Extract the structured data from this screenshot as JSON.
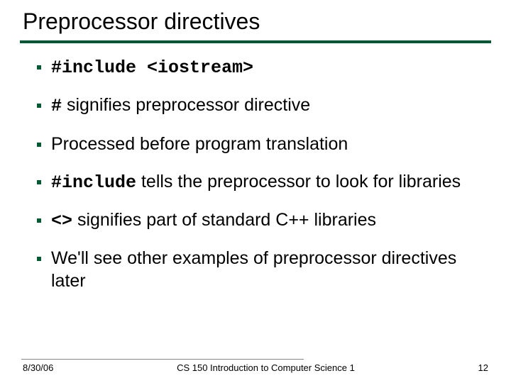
{
  "title": "Preprocessor directives",
  "bullets": {
    "b0": {
      "code": "#include <iostream>"
    },
    "b1": {
      "code": "#",
      "rest": " signifies preprocessor directive"
    },
    "b2": {
      "text": "Processed before program translation"
    },
    "b3": {
      "code": "#include",
      "rest": " tells the preprocessor to look for libraries"
    },
    "b4": {
      "code": "<>",
      "rest": " signifies part of standard C++ libraries"
    },
    "b5": {
      "text": "We'll see other examples of preprocessor directives later"
    }
  },
  "footer": {
    "date": "8/30/06",
    "course": "CS 150 Introduction to Computer Science 1",
    "page": "12"
  }
}
